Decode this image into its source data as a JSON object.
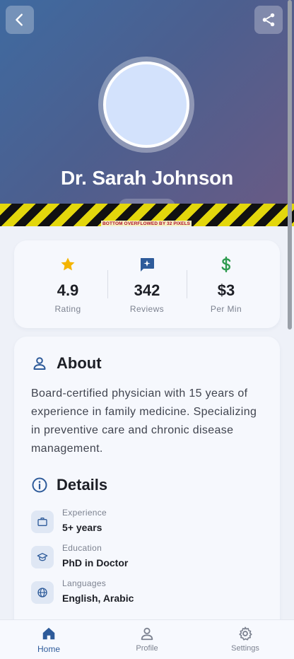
{
  "header": {
    "back_icon": "chevron-left-icon",
    "share_icon": "share-icon",
    "doctor_name": "Dr. Sarah Johnson",
    "overflow_warning": "BOTTOM OVERFLOWED BY 32 PIXELS"
  },
  "stats": [
    {
      "icon": "star-icon",
      "value": "4.9",
      "label": "Rating",
      "color": "#f4b400"
    },
    {
      "icon": "review-icon",
      "value": "342",
      "label": "Reviews",
      "color": "#2e5b9a"
    },
    {
      "icon": "dollar-icon",
      "value": "$3",
      "label": "Per Min",
      "color": "#2e9b4f"
    }
  ],
  "about": {
    "title": "About",
    "text": "Board-certified physician with 15 years of experience in family medicine. Specializing in preventive care and chronic disease management."
  },
  "details": {
    "title": "Details",
    "items": [
      {
        "icon": "briefcase-icon",
        "label": "Experience",
        "value": "5+ years"
      },
      {
        "icon": "graduation-cap-icon",
        "label": "Education",
        "value": "PhD in Doctor"
      },
      {
        "icon": "globe-icon",
        "label": "Languages",
        "value": "English, Arabic"
      }
    ]
  },
  "nav": {
    "items": [
      {
        "icon": "home-icon",
        "label": "Home",
        "active": true
      },
      {
        "icon": "profile-icon",
        "label": "Profile",
        "active": false
      },
      {
        "icon": "settings-icon",
        "label": "Settings",
        "active": false
      }
    ]
  },
  "colors": {
    "accent": "#2e5b9a",
    "header_gradient_start": "#3f6aa0",
    "header_gradient_end": "#6b5a84"
  }
}
